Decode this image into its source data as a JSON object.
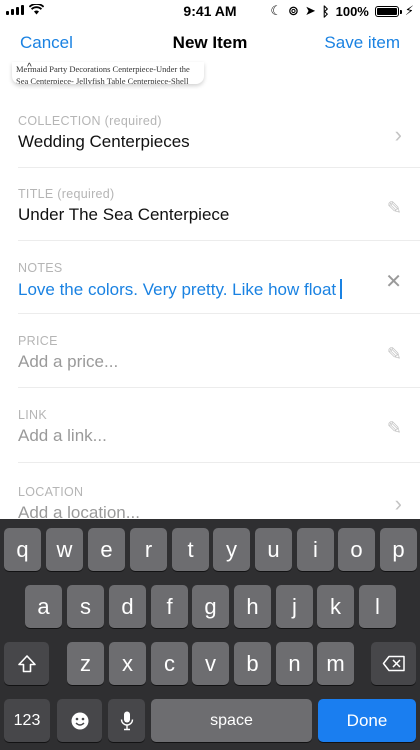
{
  "status": {
    "time": "9:41 AM",
    "battery": "100%"
  },
  "nav": {
    "cancel": "Cancel",
    "title": "New Item",
    "save": "Save item"
  },
  "preview": {
    "line1": "Mermaid Party Decorations Centerpiece-Under the",
    "line2": "Sea Centerpiece- Jellyfish Table Centerpiece-Shell"
  },
  "form": {
    "collection": {
      "label": "COLLECTION (required)",
      "value": "Wedding Centerpieces"
    },
    "title": {
      "label": "TITLE (required)",
      "value": "Under The Sea Centerpiece"
    },
    "notes": {
      "label": "NOTES",
      "value": "Love the colors. Very pretty. Like how float"
    },
    "price": {
      "label": "PRICE",
      "placeholder": "Add a price..."
    },
    "link": {
      "label": "LINK",
      "placeholder": "Add a link..."
    },
    "location": {
      "label": "LOCATION",
      "placeholder": "Add a location..."
    }
  },
  "keyboard": {
    "row1": [
      "q",
      "w",
      "e",
      "r",
      "t",
      "y",
      "u",
      "i",
      "o",
      "p"
    ],
    "row2": [
      "a",
      "s",
      "d",
      "f",
      "g",
      "h",
      "j",
      "k",
      "l"
    ],
    "row3": [
      "z",
      "x",
      "c",
      "v",
      "b",
      "n",
      "m"
    ],
    "numbers": "123",
    "space": "space",
    "done": "Done"
  },
  "colors": {
    "accent": "#1a82e2",
    "keyboard_bg": "#2f2f31",
    "key": "#6d6d70",
    "done": "#1a7ef0"
  }
}
